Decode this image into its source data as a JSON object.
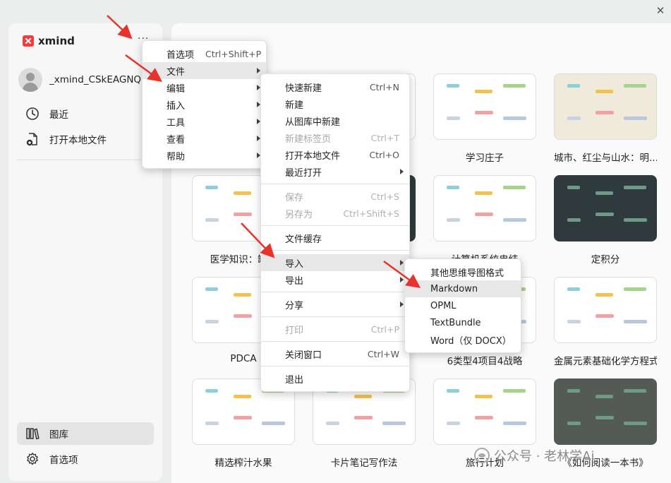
{
  "app": {
    "name": "xmind"
  },
  "window": {
    "close_glyph": "✕"
  },
  "sidebar": {
    "more_glyph": "···",
    "account_name": "_xmind_CSkEAGNQhE",
    "nav_top": [
      {
        "label": "最近",
        "icon": "clock-icon"
      },
      {
        "label": "打开本地文件",
        "icon": "file-plus-icon"
      }
    ],
    "nav_bottom": [
      {
        "label": "图库",
        "icon": "library-icon"
      },
      {
        "label": "首选项",
        "icon": "gear-icon"
      }
    ]
  },
  "gallery": {
    "cards": [
      {
        "title": "",
        "style": "light"
      },
      {
        "title": "",
        "style": "light"
      },
      {
        "title": "学习庄子",
        "style": "light"
      },
      {
        "title": "城市、红尘与山水：明...",
        "style": "paper"
      },
      {
        "title": "医学知识：缺血",
        "style": "light"
      },
      {
        "title": "",
        "style": "dark"
      },
      {
        "title": "计算机系统串结",
        "style": "light"
      },
      {
        "title": "定积分",
        "style": "dark"
      },
      {
        "title": "PDCA",
        "style": "light"
      },
      {
        "title": "",
        "style": "light"
      },
      {
        "title": "6类型4项目4战略",
        "style": "light"
      },
      {
        "title": "金属元素基础化学方程式",
        "style": "light"
      },
      {
        "title": "精选榨汁水果",
        "style": "light"
      },
      {
        "title": "卡片笔记写作法",
        "style": "light"
      },
      {
        "title": "旅行计划",
        "style": "light"
      },
      {
        "title": "《如何阅读一本书》",
        "style": "gray"
      }
    ]
  },
  "menus": {
    "main": [
      {
        "label": "首选项",
        "shortcut": "Ctrl+Shift+P",
        "submenu": false
      },
      {
        "label": "文件",
        "shortcut": "",
        "submenu": true
      },
      {
        "label": "编辑",
        "shortcut": "",
        "submenu": true
      },
      {
        "label": "插入",
        "shortcut": "",
        "submenu": true
      },
      {
        "label": "工具",
        "shortcut": "",
        "submenu": true
      },
      {
        "label": "查看",
        "shortcut": "",
        "submenu": true
      },
      {
        "label": "帮助",
        "shortcut": "",
        "submenu": true
      }
    ],
    "file": {
      "group1": [
        {
          "label": "快速新建",
          "shortcut": "Ctrl+N",
          "disabled": false,
          "submenu": false
        },
        {
          "label": "新建",
          "shortcut": "",
          "disabled": false,
          "submenu": false
        },
        {
          "label": "从图库中新建",
          "shortcut": "",
          "disabled": false,
          "submenu": false
        },
        {
          "label": "新建标签页",
          "shortcut": "Ctrl+T",
          "disabled": true,
          "submenu": false
        },
        {
          "label": "打开本地文件",
          "shortcut": "Ctrl+O",
          "disabled": false,
          "submenu": false
        },
        {
          "label": "最近打开",
          "shortcut": "",
          "disabled": false,
          "submenu": true
        }
      ],
      "group2": [
        {
          "label": "保存",
          "shortcut": "Ctrl+S",
          "disabled": true
        },
        {
          "label": "另存为",
          "shortcut": "Ctrl+Shift+S",
          "disabled": true
        }
      ],
      "group3": [
        {
          "label": "文件缓存",
          "shortcut": ""
        }
      ],
      "group4": [
        {
          "label": "导入",
          "submenu": true
        },
        {
          "label": "导出",
          "submenu": true
        }
      ],
      "group5": [
        {
          "label": "分享",
          "submenu": true
        }
      ],
      "group6": [
        {
          "label": "打印",
          "shortcut": "Ctrl+P",
          "disabled": true
        }
      ],
      "group7": [
        {
          "label": "关闭窗口",
          "shortcut": "Ctrl+W"
        }
      ],
      "group8": [
        {
          "label": "退出"
        }
      ]
    },
    "import": [
      "其他思维导图格式",
      "Markdown",
      "OPML",
      "TextBundle",
      "Word（仅 DOCX）"
    ]
  },
  "watermark": {
    "text": "公众号 · 老林学Ai"
  },
  "colors": {
    "accent_red": "#f03e3e",
    "menu_highlight": "#e8e8e8",
    "arrow_red": "#e8332a"
  }
}
